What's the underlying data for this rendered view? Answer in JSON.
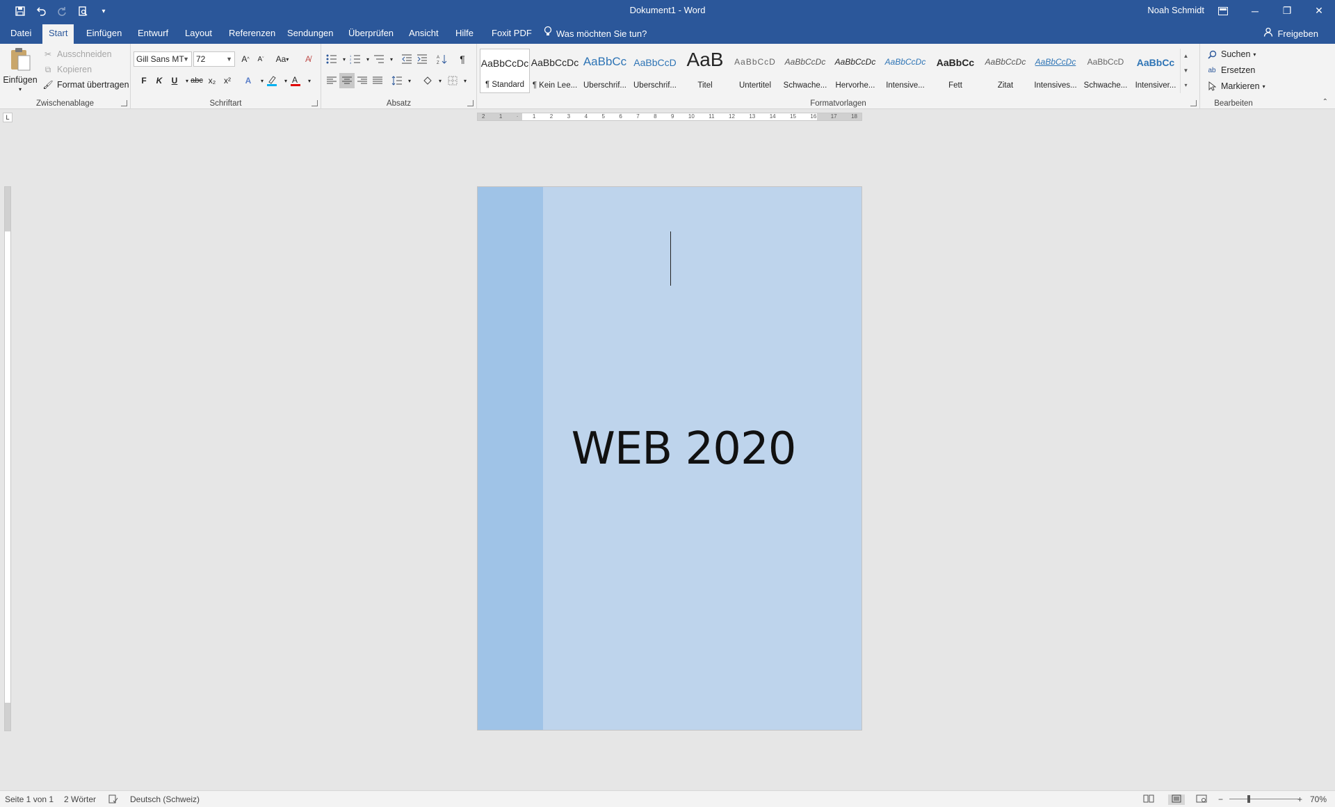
{
  "window": {
    "title": "Dokument1  -  Word",
    "user": "Noah Schmidt",
    "controls": {
      "minimize": "─",
      "restore": "❐",
      "close": "✕"
    }
  },
  "quick_access": [
    "save-icon",
    "undo-icon",
    "redo-icon",
    "print-preview-icon",
    "customize-icon"
  ],
  "tabs": [
    {
      "label": "Datei"
    },
    {
      "label": "Start"
    },
    {
      "label": "Einfügen"
    },
    {
      "label": "Entwurf"
    },
    {
      "label": "Layout"
    },
    {
      "label": "Referenzen"
    },
    {
      "label": "Sendungen"
    },
    {
      "label": "Überprüfen"
    },
    {
      "label": "Ansicht"
    },
    {
      "label": "Hilfe"
    },
    {
      "label": "Foxit PDF"
    }
  ],
  "tell_me": "Was möchten Sie tun?",
  "share": "Freigeben",
  "clipboard": {
    "label": "Zwischenablage",
    "paste": "Einfügen",
    "cut": "Ausschneiden",
    "copy": "Kopieren",
    "format_painter": "Format übertragen"
  },
  "font": {
    "label": "Schriftart",
    "family": "Gill Sans MT",
    "size": "72",
    "bold": "F",
    "italic": "K",
    "underline": "U",
    "strike": "abc",
    "subscript": "x₂",
    "superscript": "x²",
    "change_case": "Aa"
  },
  "paragraph": {
    "label": "Absatz"
  },
  "styles": {
    "label": "Formatvorlagen",
    "items": [
      {
        "preview": "AaBbCcDc",
        "name": "¶ Standard"
      },
      {
        "preview": "AaBbCcDc",
        "name": "¶ Kein Lee..."
      },
      {
        "preview": "AaBbCc",
        "name": "Überschrif..."
      },
      {
        "preview": "AaBbCcD",
        "name": "Überschrif..."
      },
      {
        "preview": "AaB",
        "name": "Titel"
      },
      {
        "preview": "AaBbCcD",
        "name": "Untertitel"
      },
      {
        "preview": "AaBbCcDc",
        "name": "Schwache..."
      },
      {
        "preview": "AaBbCcDc",
        "name": "Hervorhe..."
      },
      {
        "preview": "AaBbCcDc",
        "name": "Intensive..."
      },
      {
        "preview": "AaBbCc",
        "name": "Fett"
      },
      {
        "preview": "AaBbCcDc",
        "name": "Zitat"
      },
      {
        "preview": "AaBbCcDc",
        "name": "Intensives..."
      },
      {
        "preview": "AaBbCcD",
        "name": "Schwache..."
      },
      {
        "preview": "AaBbCc",
        "name": "Intensiver..."
      }
    ]
  },
  "editing": {
    "label": "Bearbeiten",
    "find": "Suchen",
    "replace": "Ersetzen",
    "select": "Markieren"
  },
  "document": {
    "headline": "WEB 2020",
    "page_color": "#bed4ec",
    "sidebar_color": "#9fc3e7"
  },
  "ruler": {
    "h_ticks": [
      "2",
      "1",
      "",
      "1",
      "2",
      "3",
      "4",
      "5",
      "6",
      "7",
      "8",
      "9",
      "10",
      "11",
      "12",
      "13",
      "14",
      "15",
      "16",
      "17",
      "18"
    ]
  },
  "status": {
    "page": "Seite 1 von 1",
    "words": "2 Wörter",
    "language": "Deutsch (Schweiz)",
    "zoom": "70%"
  },
  "colors": {
    "accent": "#2b579a",
    "highlight": "#00b0f0",
    "font_color": "#e00000"
  }
}
